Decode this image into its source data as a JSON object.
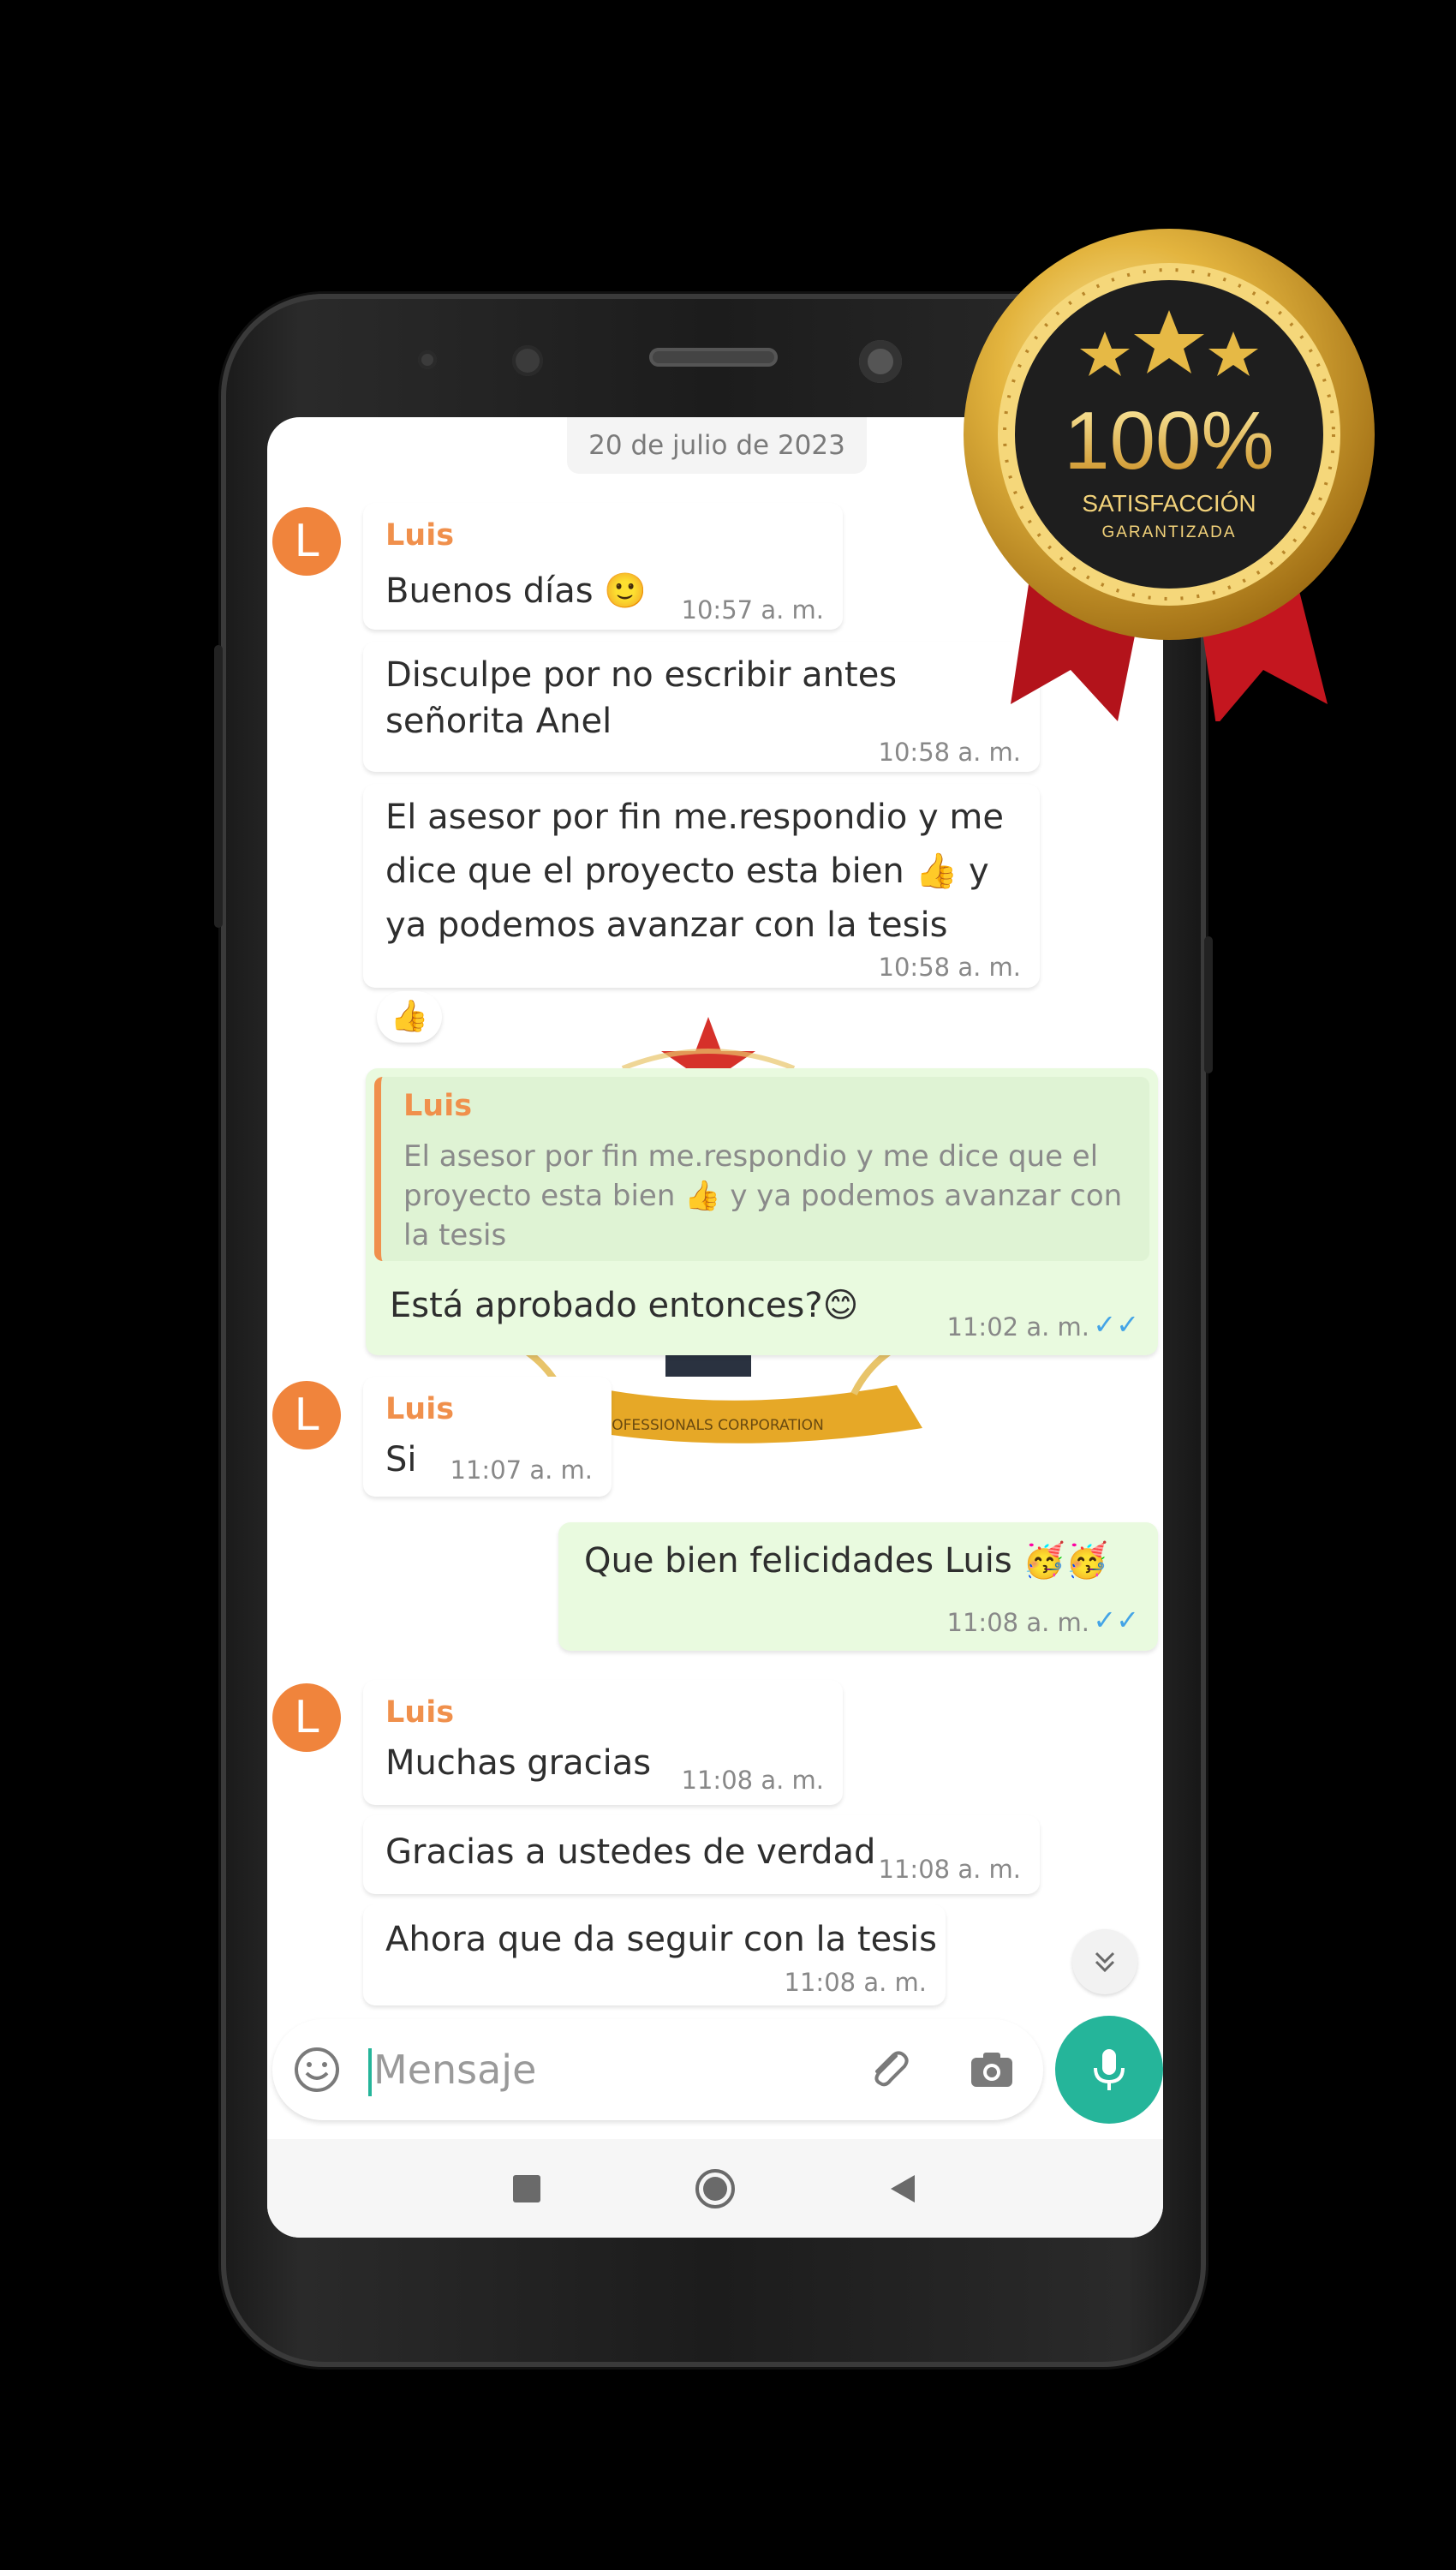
{
  "chat": {
    "date": "20 de julio de 2023",
    "avatar_letter": "L",
    "contact_name": "Luis",
    "messages": [
      {
        "text": "Buenos días 🙂",
        "time": "10:57 a. m."
      },
      {
        "text": "Disculpe por no escribir antes señorita Anel",
        "time": "10:58 a. m."
      },
      {
        "text": "El asesor por fin me.respondio y me dice que el proyecto esta bien 👍 y ya podemos avanzar con la tesis",
        "time": "10:58 a. m."
      },
      {
        "reaction": "👍"
      },
      {
        "quoted_name": "Luis",
        "quoted_text": "El asesor por fin me.respondio y me dice que el proyecto esta bien 👍 y ya podemos avanzar con la tesis",
        "text": "Está aprobado entonces?😊",
        "time": "11:02 a. m.",
        "ticks": "✓✓"
      },
      {
        "text": "Si",
        "time": "11:07 a. m."
      },
      {
        "text": "Que bien felicidades Luis 🥳🥳",
        "time": "11:08 a. m.",
        "ticks": "✓✓"
      },
      {
        "text": "Muchas gracias",
        "time": "11:08 a. m."
      },
      {
        "text": "Gracias a ustedes de verdad",
        "time": "11:08 a. m."
      },
      {
        "text": "Ahora que da seguir con la tesis",
        "time": "11:08 a. m."
      }
    ]
  },
  "composer": {
    "placeholder": "Mensaje"
  },
  "watermark": {
    "text": "PROFESSIONALS CORPORATION"
  },
  "badge": {
    "percent": "100%",
    "line1": "SATISFACCIÓN",
    "line2": "GARANTIZADA"
  },
  "colors": {
    "accent": "#25b59a",
    "sender": "#f0904c",
    "outgoing_bubble": "#e9fadf",
    "ticks": "#44a4e6"
  },
  "icons": [
    "emoji-icon",
    "attach-icon",
    "camera-icon",
    "mic-icon",
    "scroll-down-icon",
    "nav-square-icon",
    "nav-home-icon",
    "nav-back-icon"
  ]
}
